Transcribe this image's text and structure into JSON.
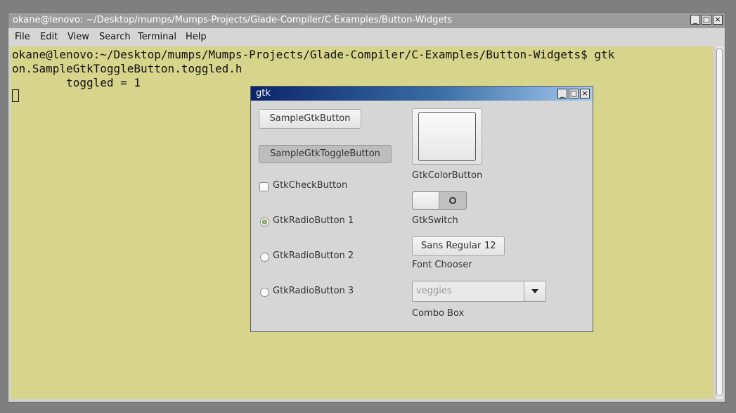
{
  "terminal": {
    "title": "okane@lenovo: ~/Desktop/mumps/Mumps-Projects/Glade-Compiler/C-Examples/Button-Widgets",
    "menu": [
      "File",
      "Edit",
      "View",
      "Search",
      "Terminal",
      "Help"
    ],
    "lines": [
      "okane@lenovo:~/Desktop/mumps/Mumps-Projects/Glade-Compiler/C-Examples/Button-Widgets$ gtk",
      "on.SampleGtkToggleButton.toggled.h",
      "        toggled = 1"
    ]
  },
  "gtk_window": {
    "title": "gtk",
    "button_label": "SampleGtkButton",
    "toggle_button_label": "SampleGtkToggleButton",
    "check_label": "GtkCheckButton",
    "radios": [
      {
        "label": "GtkRadioButton 1",
        "selected": true
      },
      {
        "label": "GtkRadioButton 2",
        "selected": false
      },
      {
        "label": "GtkRadioButton 3",
        "selected": false
      }
    ],
    "color_button_label": "GtkColorButton",
    "switch_label": "GtkSwitch",
    "font_button": {
      "name": "Sans Regular",
      "size": "12"
    },
    "font_chooser_label": "Font Chooser",
    "combo_placeholder": "veggies",
    "combo_label": "Combo Box"
  },
  "wm_buttons": {
    "minimize": "_",
    "maximize": "□",
    "close": "×"
  }
}
